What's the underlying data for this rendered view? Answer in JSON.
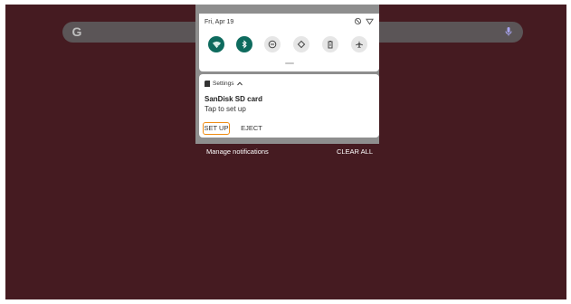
{
  "launcher": {
    "search_logo": "G",
    "icons": [
      "google-icon",
      "mic-icon"
    ]
  },
  "quick_settings": {
    "date": "Fri, Apr 19",
    "status_icons": [
      "dnd-icon",
      "wifi-icon"
    ],
    "tiles": [
      {
        "name": "wifi-tile",
        "icon": "wifi-icon",
        "state": "on"
      },
      {
        "name": "bluetooth-tile",
        "icon": "bluetooth-icon",
        "state": "on"
      },
      {
        "name": "dnd-tile",
        "icon": "dnd-icon",
        "state": "off"
      },
      {
        "name": "auto-rotate-tile",
        "icon": "rotate-icon",
        "state": "off"
      },
      {
        "name": "battery-saver-tile",
        "icon": "battery-icon",
        "state": "off"
      },
      {
        "name": "airplane-tile",
        "icon": "airplane-icon",
        "state": "off"
      }
    ]
  },
  "notification": {
    "app_name": "Settings",
    "title": "SanDisk SD card",
    "body": "Tap to set up",
    "actions": {
      "setup": "SET UP",
      "eject": "EJECT"
    }
  },
  "footer": {
    "manage": "Manage notifications",
    "clear_all": "CLEAR ALL"
  },
  "colors": {
    "wallpaper": "#451b21",
    "tile_on": "#0e6b5e",
    "focus_ring": "#ef8b12"
  }
}
